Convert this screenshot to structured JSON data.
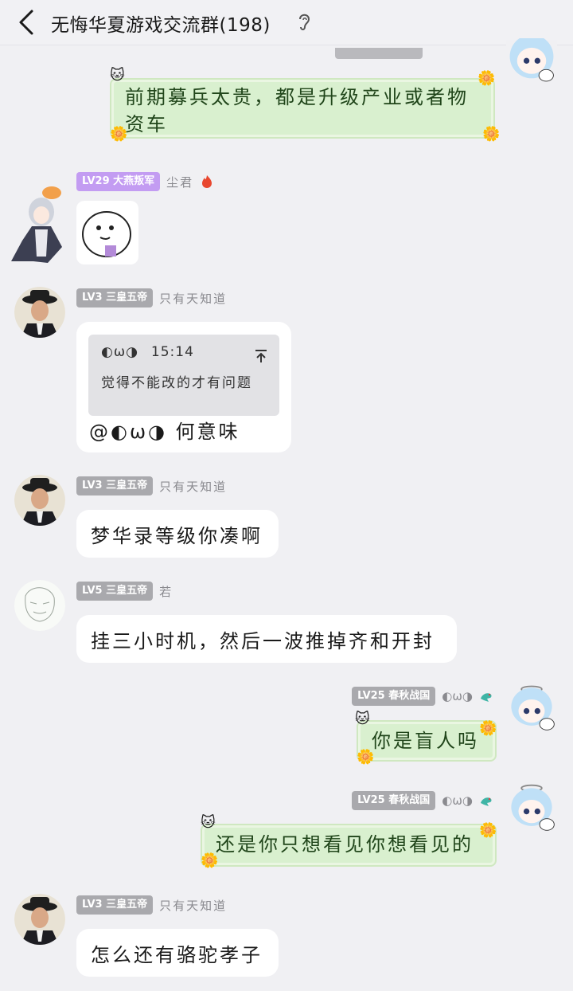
{
  "header": {
    "title": "无悔华夏游戏交流群(198)"
  },
  "messages": [
    {
      "id": "m1",
      "text": "前期募兵太贵，都是升级产业或者物资车"
    },
    {
      "id": "m2",
      "level": "LV29 大燕叛军",
      "nick": "尘君"
    },
    {
      "id": "m3",
      "level": "LV3 三皇五帝",
      "nick": "只有天知道",
      "quote": {
        "author": "◐ω◑",
        "time": "15:14",
        "text": "觉得不能改的才有问题"
      },
      "text": "@◐ω◑ 何意味"
    },
    {
      "id": "m4",
      "level": "LV3 三皇五帝",
      "nick": "只有天知道",
      "text": "梦华录等级你凑啊"
    },
    {
      "id": "m5",
      "level": "LV5 三皇五帝",
      "nick": "若",
      "text": "挂三小时机，然后一波推掉齐和开封"
    },
    {
      "id": "m6",
      "level": "LV25 春秋战国",
      "nick": "◐ω◑",
      "text": "你是盲人吗"
    },
    {
      "id": "m7",
      "level": "LV25 春秋战国",
      "nick": "◐ω◑",
      "text": "还是你只想看见你想看见的"
    },
    {
      "id": "m8",
      "level": "LV3 三皇五帝",
      "nick": "只有天知道",
      "text": "怎么还有骆驼孝子"
    }
  ],
  "colors": {
    "background": "#f0f0f3",
    "bubble": "#ffffff",
    "green_bubble": "#d9f0cf",
    "badge_gray": "#a9a9ad",
    "badge_purple": "#c39cf2"
  },
  "icons": [
    "back-arrow-icon",
    "ear-icon",
    "fire-icon",
    "dragon-icon",
    "quote-collapse-icon"
  ]
}
